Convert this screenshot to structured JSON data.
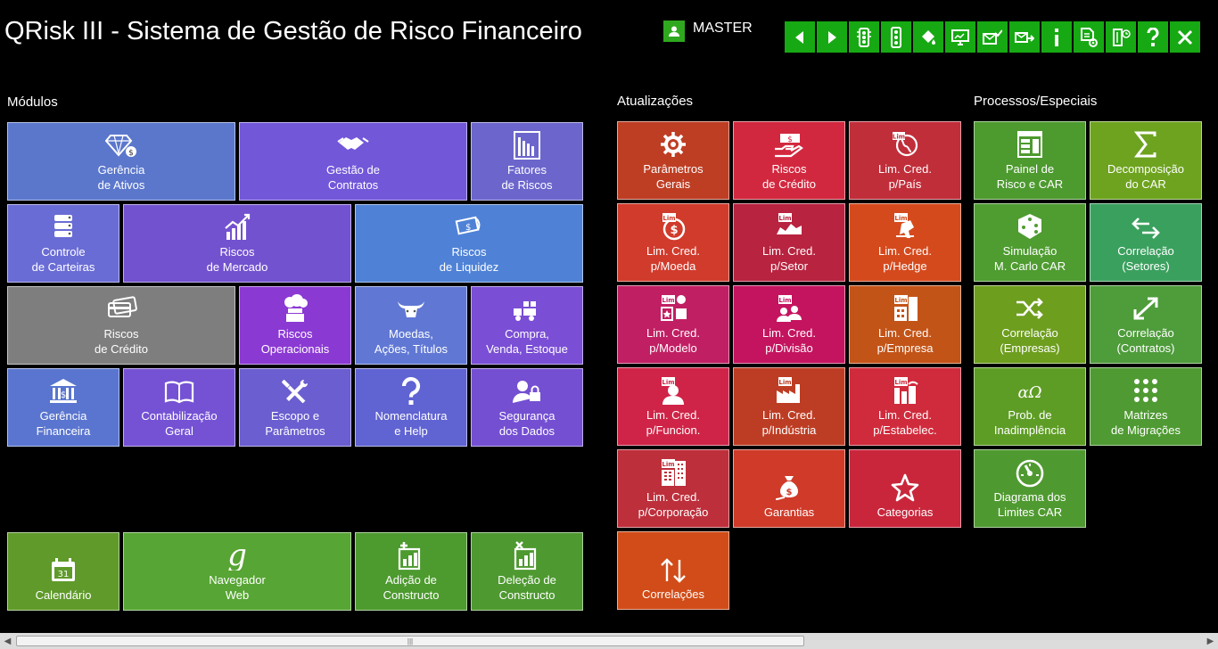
{
  "header": {
    "title": "QRisk III - Sistema de Gestão de Risco Financeiro",
    "user": {
      "icon": "user-icon",
      "name": "MASTER"
    }
  },
  "toolbar": {
    "color": "#17a913",
    "buttons": [
      {
        "icon": "arrow-left-icon"
      },
      {
        "icon": "arrow-right-icon"
      },
      {
        "icon": "traffic-light-icon"
      },
      {
        "icon": "traffic-light-outline-icon"
      },
      {
        "icon": "paint-bucket-icon"
      },
      {
        "icon": "monitor-icon"
      },
      {
        "icon": "envelope-check-icon"
      },
      {
        "icon": "envelope-forward-icon"
      },
      {
        "icon": "info-icon"
      },
      {
        "icon": "document-settings-icon"
      },
      {
        "icon": "exit-door-icon"
      },
      {
        "icon": "help-icon"
      },
      {
        "icon": "close-icon"
      }
    ]
  },
  "sections": {
    "modulos": "Módulos",
    "atualizacoes": "Atualizações",
    "processos": "Processos/Especiais"
  },
  "tiles": [
    {
      "id": "gerencia-ativos",
      "label": "Gerência\nde Ativos",
      "icon": "diamond-money-icon",
      "color": "#5b77cc"
    },
    {
      "id": "gestao-contratos",
      "label": "Gestão de\nContratos",
      "icon": "handshake-icon",
      "color": "#7257d9"
    },
    {
      "id": "fatores-riscos",
      "label": "Fatores\nde  Riscos",
      "icon": "bar-chart-icon",
      "color": "#6c66cc"
    },
    {
      "id": "controle-carteiras",
      "label": "Controle\nde Carteiras",
      "icon": "database-icon",
      "color": "#6a6cd5"
    },
    {
      "id": "riscos-mercado",
      "label": "Riscos\nde  Mercado",
      "icon": "chart-up-icon",
      "color": "#7352cf"
    },
    {
      "id": "riscos-liquidez",
      "label": "Riscos\nde Liquidez",
      "icon": "money-flow-icon",
      "color": "#4f82d6"
    },
    {
      "id": "riscos-credito",
      "label": "Riscos\nde  Crédito",
      "icon": "credit-cards-icon",
      "color": "#7e7e7e"
    },
    {
      "id": "riscos-operacionais",
      "label": "Riscos\nOperacionais",
      "icon": "factory-icon",
      "color": "#8b39d3"
    },
    {
      "id": "moedas-acoes",
      "label": "Moedas,\nAções, Títulos",
      "icon": "bull-icon",
      "color": "#6078d4"
    },
    {
      "id": "compra-venda",
      "label": "Compra,\nVenda, Estoque",
      "icon": "truck-icon",
      "color": "#7a4ed5"
    },
    {
      "id": "gerencia-financeira",
      "label": "Gerência\nFinanceira",
      "icon": "bank-icon",
      "color": "#5a75cf"
    },
    {
      "id": "contabilizacao-geral",
      "label": "Contabilização\nGeral",
      "icon": "book-icon",
      "color": "#7552d4"
    },
    {
      "id": "escopo-parametros",
      "label": "Escopo e\nParâmetros",
      "icon": "tools-icon",
      "color": "#6a5ed0"
    },
    {
      "id": "nomenclatura-help",
      "label": "Nomenclatura\ne Help",
      "icon": "question-icon",
      "color": "#6063d2"
    },
    {
      "id": "seguranca-dados",
      "label": "Segurança\ndos Dados",
      "icon": "user-lock-icon",
      "color": "#744fd2"
    },
    {
      "id": "calendario",
      "label": "Calendário",
      "icon": "calendar-icon",
      "color": "#5f9a2a"
    },
    {
      "id": "navegador-web",
      "label": "Navegador\nWeb",
      "icon": "google-icon",
      "color": "#57a534"
    },
    {
      "id": "adicao-constructo",
      "label": "Adição de\nConstructo",
      "icon": "add-chart-icon",
      "color": "#4d9a2f"
    },
    {
      "id": "delecao-constructo",
      "label": "Deleção de\nConstructo",
      "icon": "delete-chart-icon",
      "color": "#4e9930"
    },
    {
      "id": "parametros-gerais",
      "label": "Parâmetros\nGerais",
      "icon": "gear-icon",
      "color": "#be3e24"
    },
    {
      "id": "riscos-de-credito",
      "label": "Riscos\nde Crédito",
      "icon": "hand-money-icon",
      "color": "#d2283f"
    },
    {
      "id": "lim-pais",
      "label": "Lim. Cred.\np/País",
      "icon": "globe-lim-icon",
      "color": "#c02e3a"
    },
    {
      "id": "lim-moeda",
      "label": "Lim. Cred.\np/Moeda",
      "icon": "coin-lim-icon",
      "color": "#d13b2c"
    },
    {
      "id": "lim-setor",
      "label": "Lim. Cred.\np/Setor",
      "icon": "sector-lim-icon",
      "color": "#b8233f"
    },
    {
      "id": "lim-hedge",
      "label": "Lim. Cred.\np/Hedge",
      "icon": "hedge-lim-icon",
      "color": "#d54a1d"
    },
    {
      "id": "lim-modelo",
      "label": "Lim. Cred.\np/Modelo",
      "icon": "model-lim-icon",
      "color": "#c11f63"
    },
    {
      "id": "lim-divisao",
      "label": "Lim. Cred.\np/Divisão",
      "icon": "division-lim-icon",
      "color": "#c4145f"
    },
    {
      "id": "lim-empresa",
      "label": "Lim. Cred.\np/Empresa",
      "icon": "company-lim-icon",
      "color": "#c35418"
    },
    {
      "id": "lim-funcion",
      "label": "Lim. Cred.\np/Funcion.",
      "icon": "employee-lim-icon",
      "color": "#cf2447"
    },
    {
      "id": "lim-industria",
      "label": "Lim. Cred.\np/Indústria",
      "icon": "industry-lim-icon",
      "color": "#bd3d24"
    },
    {
      "id": "lim-estabelec",
      "label": "Lim. Cred.\np/Estabelec.",
      "icon": "establishment-lim-icon",
      "color": "#d02b3c"
    },
    {
      "id": "lim-corporacao",
      "label": "Lim. Cred.\np/Corporação",
      "icon": "corporation-lim-icon",
      "color": "#bd2f3b"
    },
    {
      "id": "garantias",
      "label": "Garantias",
      "icon": "money-bag-icon",
      "color": "#cf3a29"
    },
    {
      "id": "categorias",
      "label": "Categorias",
      "icon": "star-icon",
      "color": "#c9263c"
    },
    {
      "id": "correlacoes",
      "label": "Correlações",
      "icon": "sort-arrows-icon",
      "color": "#d14c18"
    },
    {
      "id": "painel-risco",
      "label": "Painel de\nRisco e CAR",
      "icon": "dashboard-icon",
      "color": "#4d9a2f"
    },
    {
      "id": "decomposicao-car",
      "label": "Decomposição\ndo CAR",
      "icon": "sigma-icon",
      "color": "#6ea31f"
    },
    {
      "id": "simulacao-carlo",
      "label": "Simulação\nM. Carlo CAR",
      "icon": "dice-icon",
      "color": "#4f9c31"
    },
    {
      "id": "correlacao-setores",
      "label": "Correlação\n(Setores)",
      "icon": "exchange-icon",
      "color": "#3aa05e"
    },
    {
      "id": "correlacao-empresas",
      "label": "Correlação\n(Empresas)",
      "icon": "shuffle-icon",
      "color": "#6e9e1e"
    },
    {
      "id": "correlacao-contratos",
      "label": "Correlação\n(Contratos)",
      "icon": "expand-icon",
      "color": "#4e9c3a"
    },
    {
      "id": "prob-inadimplencia",
      "label": "Prob. de\nInadimplência",
      "icon": "alpha-omega-icon",
      "color": "#5e9d25"
    },
    {
      "id": "matrizes-migracoes",
      "label": "Matrizes\nde Migrações",
      "icon": "grid-dots-icon",
      "color": "#4f9a32"
    },
    {
      "id": "diagrama-limites",
      "label": "Diagrama dos\nLimites CAR",
      "icon": "gauge-icon",
      "color": "#4f9a30"
    }
  ]
}
